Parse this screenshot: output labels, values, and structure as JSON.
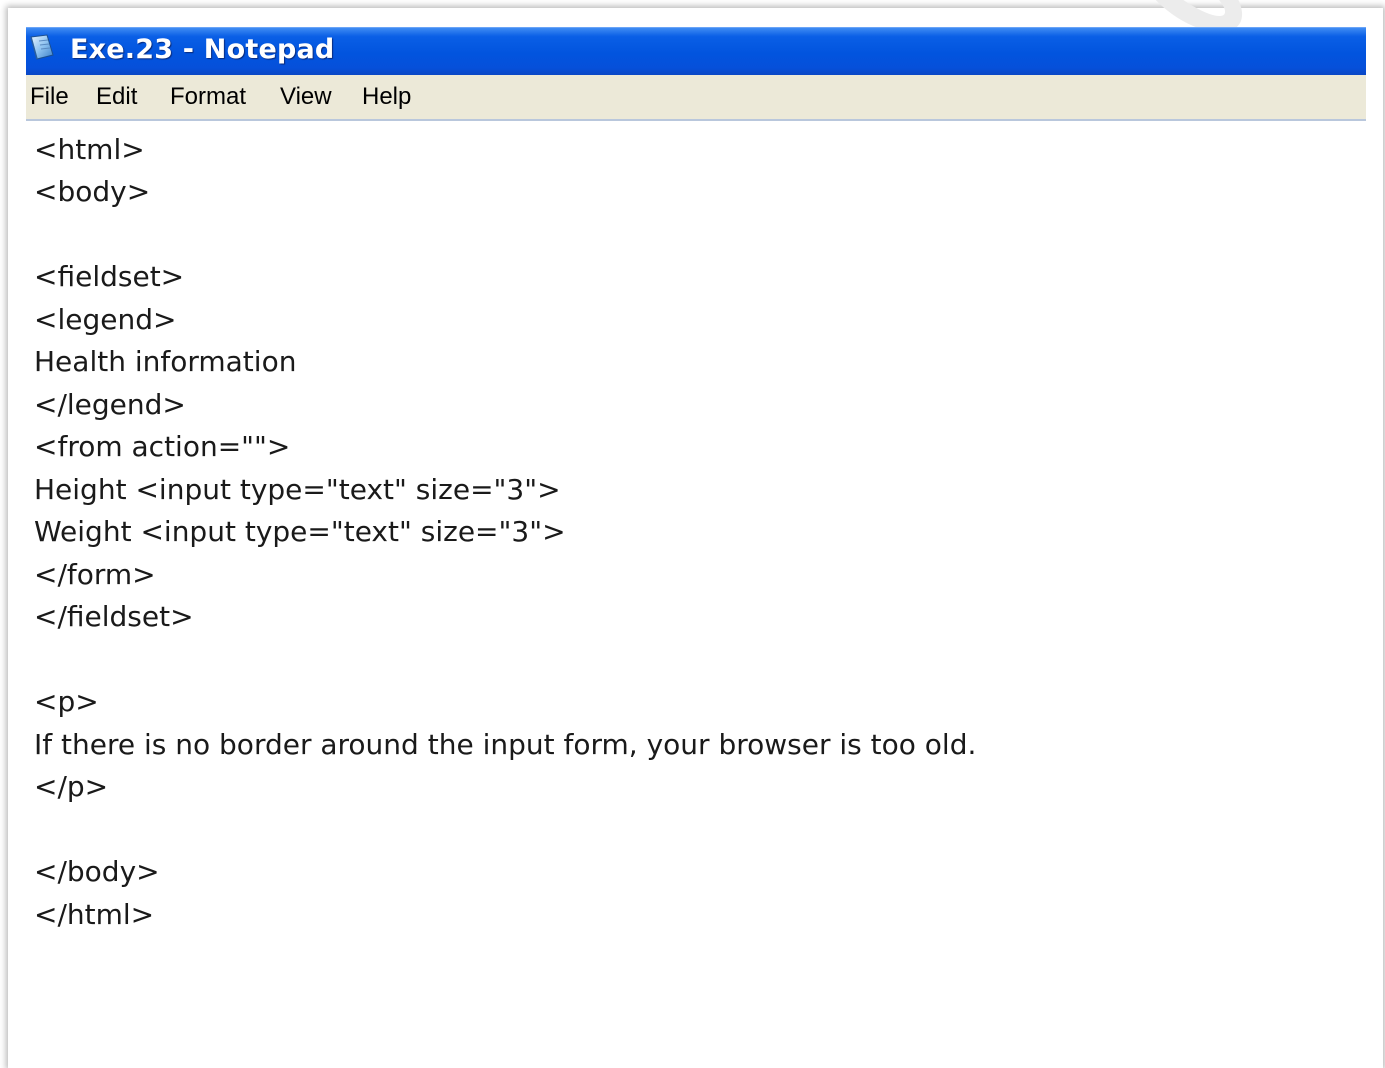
{
  "window": {
    "title": "Exe.23 - Notepad",
    "title_bar_color": "#0254de",
    "menu_bar_color": "#ece9d8"
  },
  "menu": {
    "items": [
      {
        "label": "File"
      },
      {
        "label": "Edit"
      },
      {
        "label": "Format"
      },
      {
        "label": "View"
      },
      {
        "label": "Help"
      }
    ]
  },
  "editor": {
    "lines": [
      "<html>",
      "<body>",
      "",
      "<fieldset>",
      "<legend>",
      "Health information",
      "</legend>",
      "<from action=\"\">",
      "Height <input type=\"text\" size=\"3\">",
      "Weight <input type=\"text\" size=\"3\">",
      "</form>",
      "</fieldset>",
      "",
      "<p>",
      "If there is no border around the input form, your browser is too old.",
      "</p>",
      "",
      "</body>",
      "</html>"
    ]
  },
  "icons": {
    "app_icon": "notepad-icon"
  }
}
